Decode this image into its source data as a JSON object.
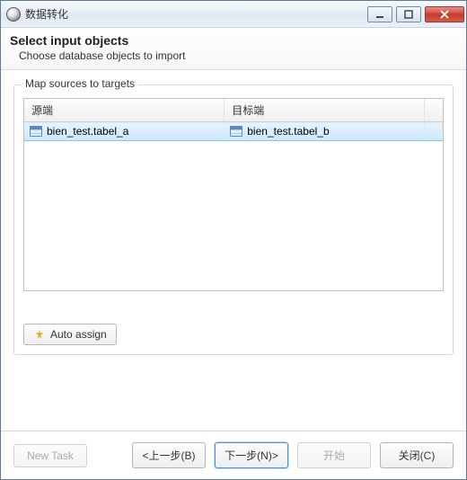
{
  "window": {
    "title": "数据转化"
  },
  "header": {
    "heading": "Select input objects",
    "subheading": "Choose database objects to import"
  },
  "group": {
    "title": "Map sources to targets",
    "columns": {
      "source": "源端",
      "target": "目标端"
    },
    "rows": [
      {
        "source": "bien_test.tabel_a",
        "target": "bien_test.tabel_b"
      }
    ],
    "auto_assign_label": "Auto assign"
  },
  "footer": {
    "new_task": "New Task",
    "back": "<上一步(B)",
    "next": "下一步(N)>",
    "start": "开始",
    "close": "关闭(C)"
  }
}
